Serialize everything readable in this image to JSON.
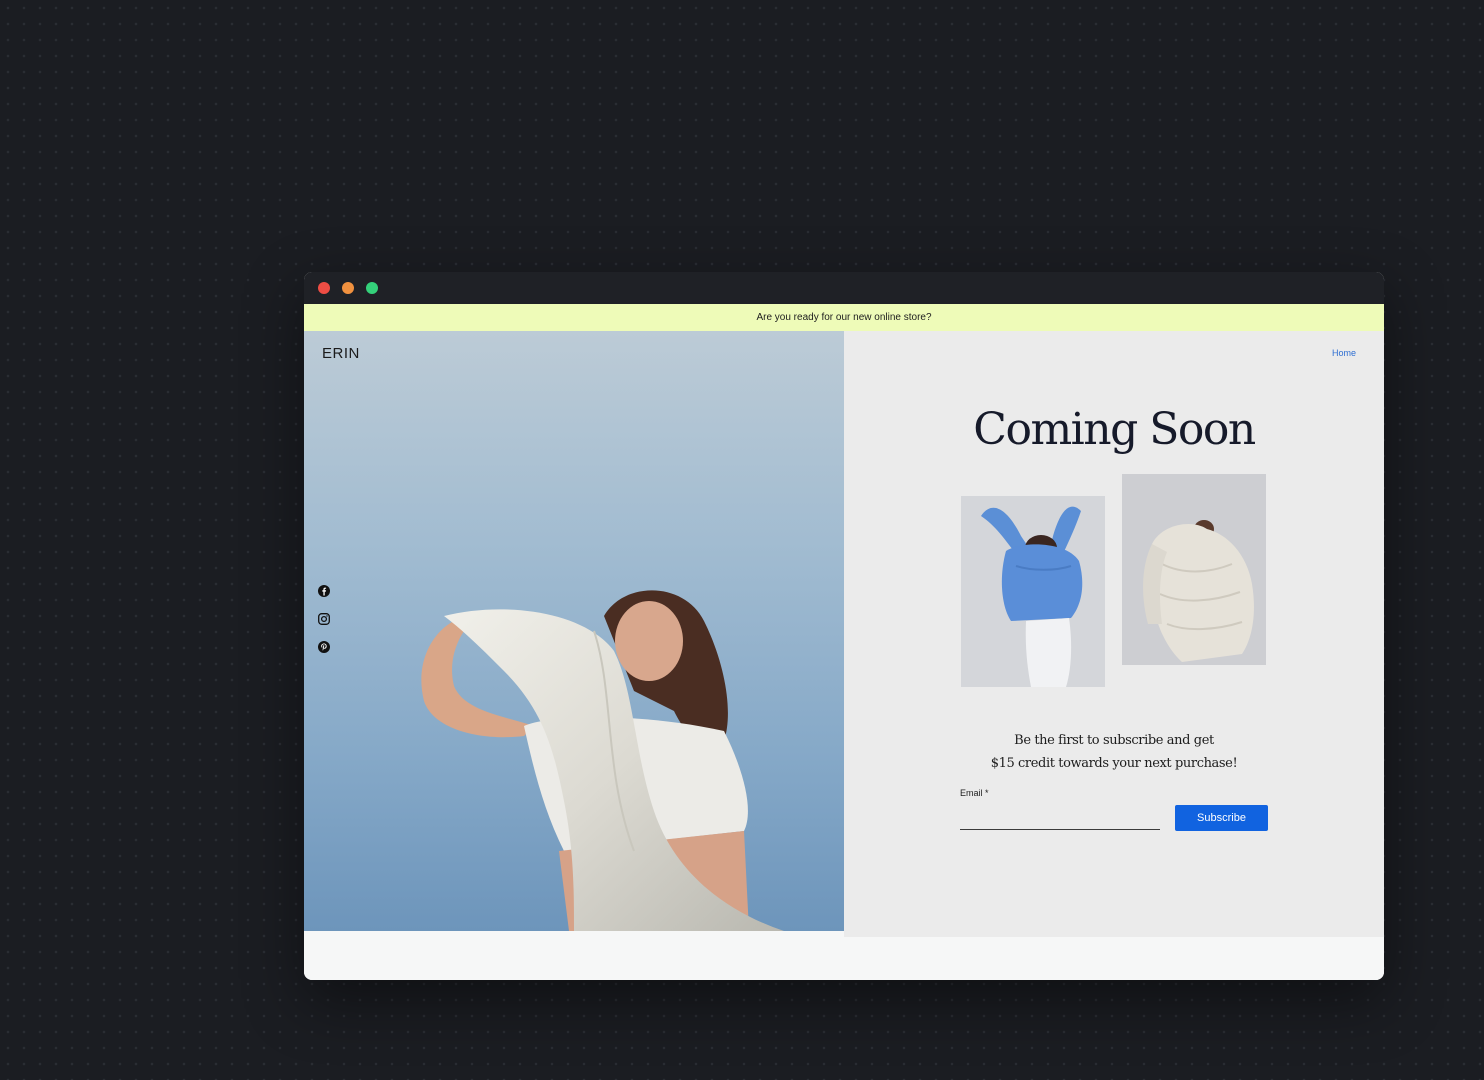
{
  "announcement": "Are you ready for our new online store?",
  "logo": "ERIN",
  "nav": {
    "home": "Home"
  },
  "headline": "Coming Soon",
  "tagline": {
    "line1": "Be the first to subscribe and get",
    "line2": "$15 credit towards your next purchase!"
  },
  "form": {
    "email_label": "Email *",
    "email_value": "",
    "subscribe_label": "Subscribe"
  },
  "social_icons": [
    "facebook-icon",
    "instagram-icon",
    "pinterest-icon"
  ],
  "colors": {
    "announcement_bg": "#eefbb8",
    "accent": "#1163e0",
    "link": "#2f6fd2",
    "right_panel_bg": "#ebebeb",
    "headline": "#161a2a"
  }
}
